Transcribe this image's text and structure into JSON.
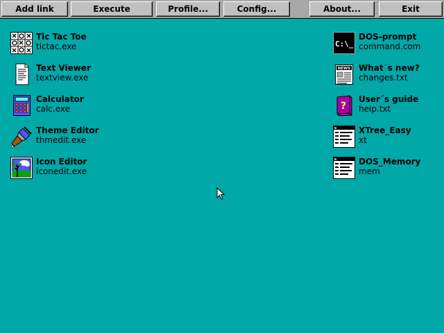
{
  "toolbar": {
    "add_link": "Add link",
    "execute": "Execute",
    "profile": "Profile...",
    "config": "Config...",
    "about": "About...",
    "exit": "Exit"
  },
  "apps_left": [
    {
      "name": "Tic Tac Toe",
      "file": "tictac.exe",
      "icon": "tic-tac-toe-icon"
    },
    {
      "name": "Text Viewer",
      "file": "textview.exe",
      "icon": "text-document-icon"
    },
    {
      "name": "Calculator",
      "file": "calc.exe",
      "icon": "calculator-icon"
    },
    {
      "name": "Theme Editor",
      "file": "thmedit.exe",
      "icon": "paintbrush-icon"
    },
    {
      "name": "Icon Editor",
      "file": "iconedit.exe",
      "icon": "picture-icon"
    }
  ],
  "apps_right": [
    {
      "name": "DOS-prompt",
      "file": "command.com",
      "icon": "dos-prompt-icon",
      "prompt_text": "C:\\_"
    },
    {
      "name": "What´s new?",
      "file": "changes.txt",
      "icon": "news-icon",
      "badge": "NEWS"
    },
    {
      "name": "User´s guide",
      "file": "help.txt",
      "icon": "help-book-icon",
      "glyph": "?"
    },
    {
      "name": "XTree_Easy",
      "file": "xt",
      "icon": "window-app-icon"
    },
    {
      "name": "DOS_Memory",
      "file": "mem",
      "icon": "window-app-icon"
    }
  ],
  "colors": {
    "desktop": "#00A8A8",
    "toolbar": "#A8A8A8",
    "button_face": "#C0C0C0"
  }
}
